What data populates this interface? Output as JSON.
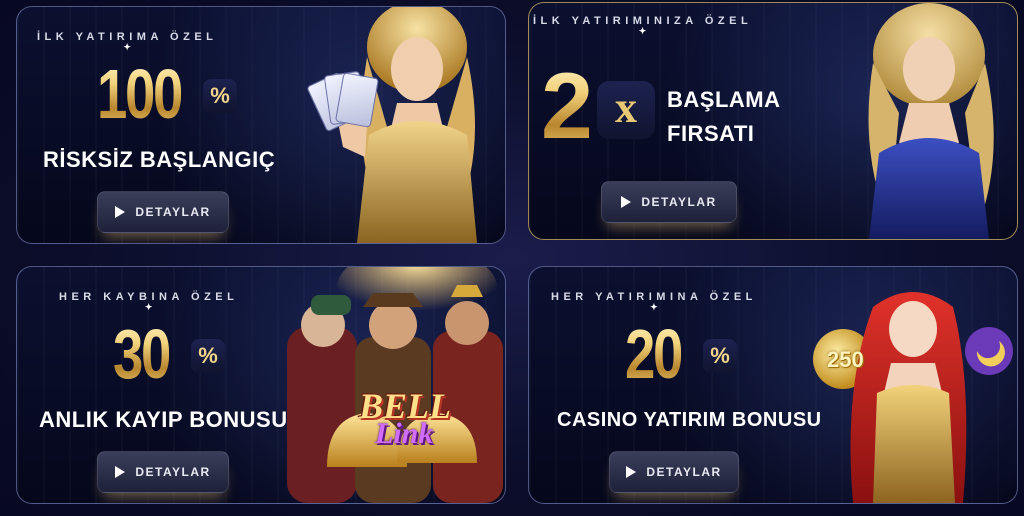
{
  "cards": [
    {
      "kicker": "İLK YATIRIMA ÖZEL",
      "amount": "100",
      "percent": "%",
      "headline": "RİSKSİZ BAŞLANGIÇ",
      "button_label": "DETAYLAR"
    },
    {
      "kicker": "İLK YATIRIMINIZA ÖZEL",
      "amount": "2",
      "multiplier": "x",
      "headline_line1": "BAŞLAMA",
      "headline_line2": "FIRSATI",
      "button_label": "DETAYLAR"
    },
    {
      "kicker": "HER KAYBINA ÖZEL",
      "amount": "30",
      "percent": "%",
      "headline": "ANLIK KAYIP BONUSU",
      "logo_line1": "BELL",
      "logo_line2": "Link",
      "button_label": "DETAYLAR"
    },
    {
      "kicker": "HER YATIRIMINA ÖZEL",
      "amount": "20",
      "percent": "%",
      "headline": "CASINO YATIRIM BONUSU",
      "badge": "250",
      "button_label": "DETAYLAR"
    }
  ],
  "colors": {
    "gold": "#e6c26a",
    "background": "#0b0d2a",
    "card_border": "#aab9ff"
  },
  "icons": [
    "play-arrow-icon"
  ]
}
